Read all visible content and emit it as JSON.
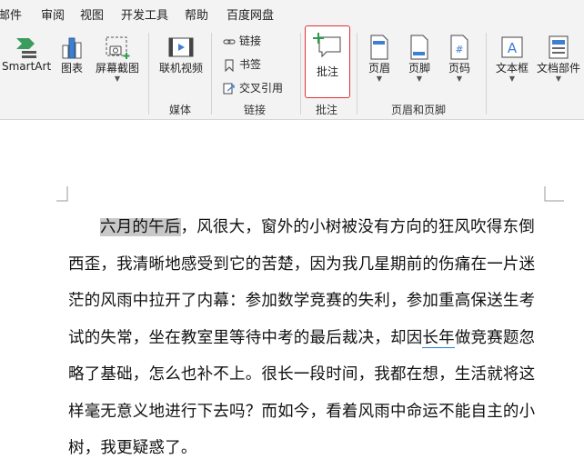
{
  "menu": {
    "items": [
      "邮件",
      "审阅",
      "视图",
      "开发工具",
      "帮助",
      "百度网盘"
    ]
  },
  "ribbon": {
    "illustrations": {
      "smartart_label": "SmartArt",
      "chart_label": "图表",
      "screenshot_label": "屏幕截图"
    },
    "media": {
      "online_video_label": "联机视频",
      "group_label": "媒体"
    },
    "links": {
      "link_label": "链接",
      "bookmark_label": "书签",
      "crossref_label": "交叉引用",
      "group_label": "链接"
    },
    "comments": {
      "comment_label": "批注",
      "group_label": "批注"
    },
    "header_footer": {
      "header_label": "页眉",
      "footer_label": "页脚",
      "page_number_label": "页码",
      "group_label": "页眉和页脚"
    },
    "text": {
      "textbox_label": "文本框",
      "quickparts_label": "文档部件"
    }
  },
  "document": {
    "highlighted": "六月的午后",
    "part1": "，风很大，窗外的小树被没有方向的狂风吹得东倒西歪，我清晰地感受到它的苦楚，因为我几星期前的伤痛在一片迷茫的风雨中拉开了内幕：参加数学竞赛的失利，参加重高保送生考试的失常，坐在教室里等待中考的最后裁决，却因",
    "underlined": "长年",
    "part2": "做竞赛题忽略了基础，怎么也补不上。很长一段时间，我都在想，生活就将这样毫无意义地进行下去吗？而如今，看着风雨中命运不能自主的小树，我更疑惑了。"
  }
}
